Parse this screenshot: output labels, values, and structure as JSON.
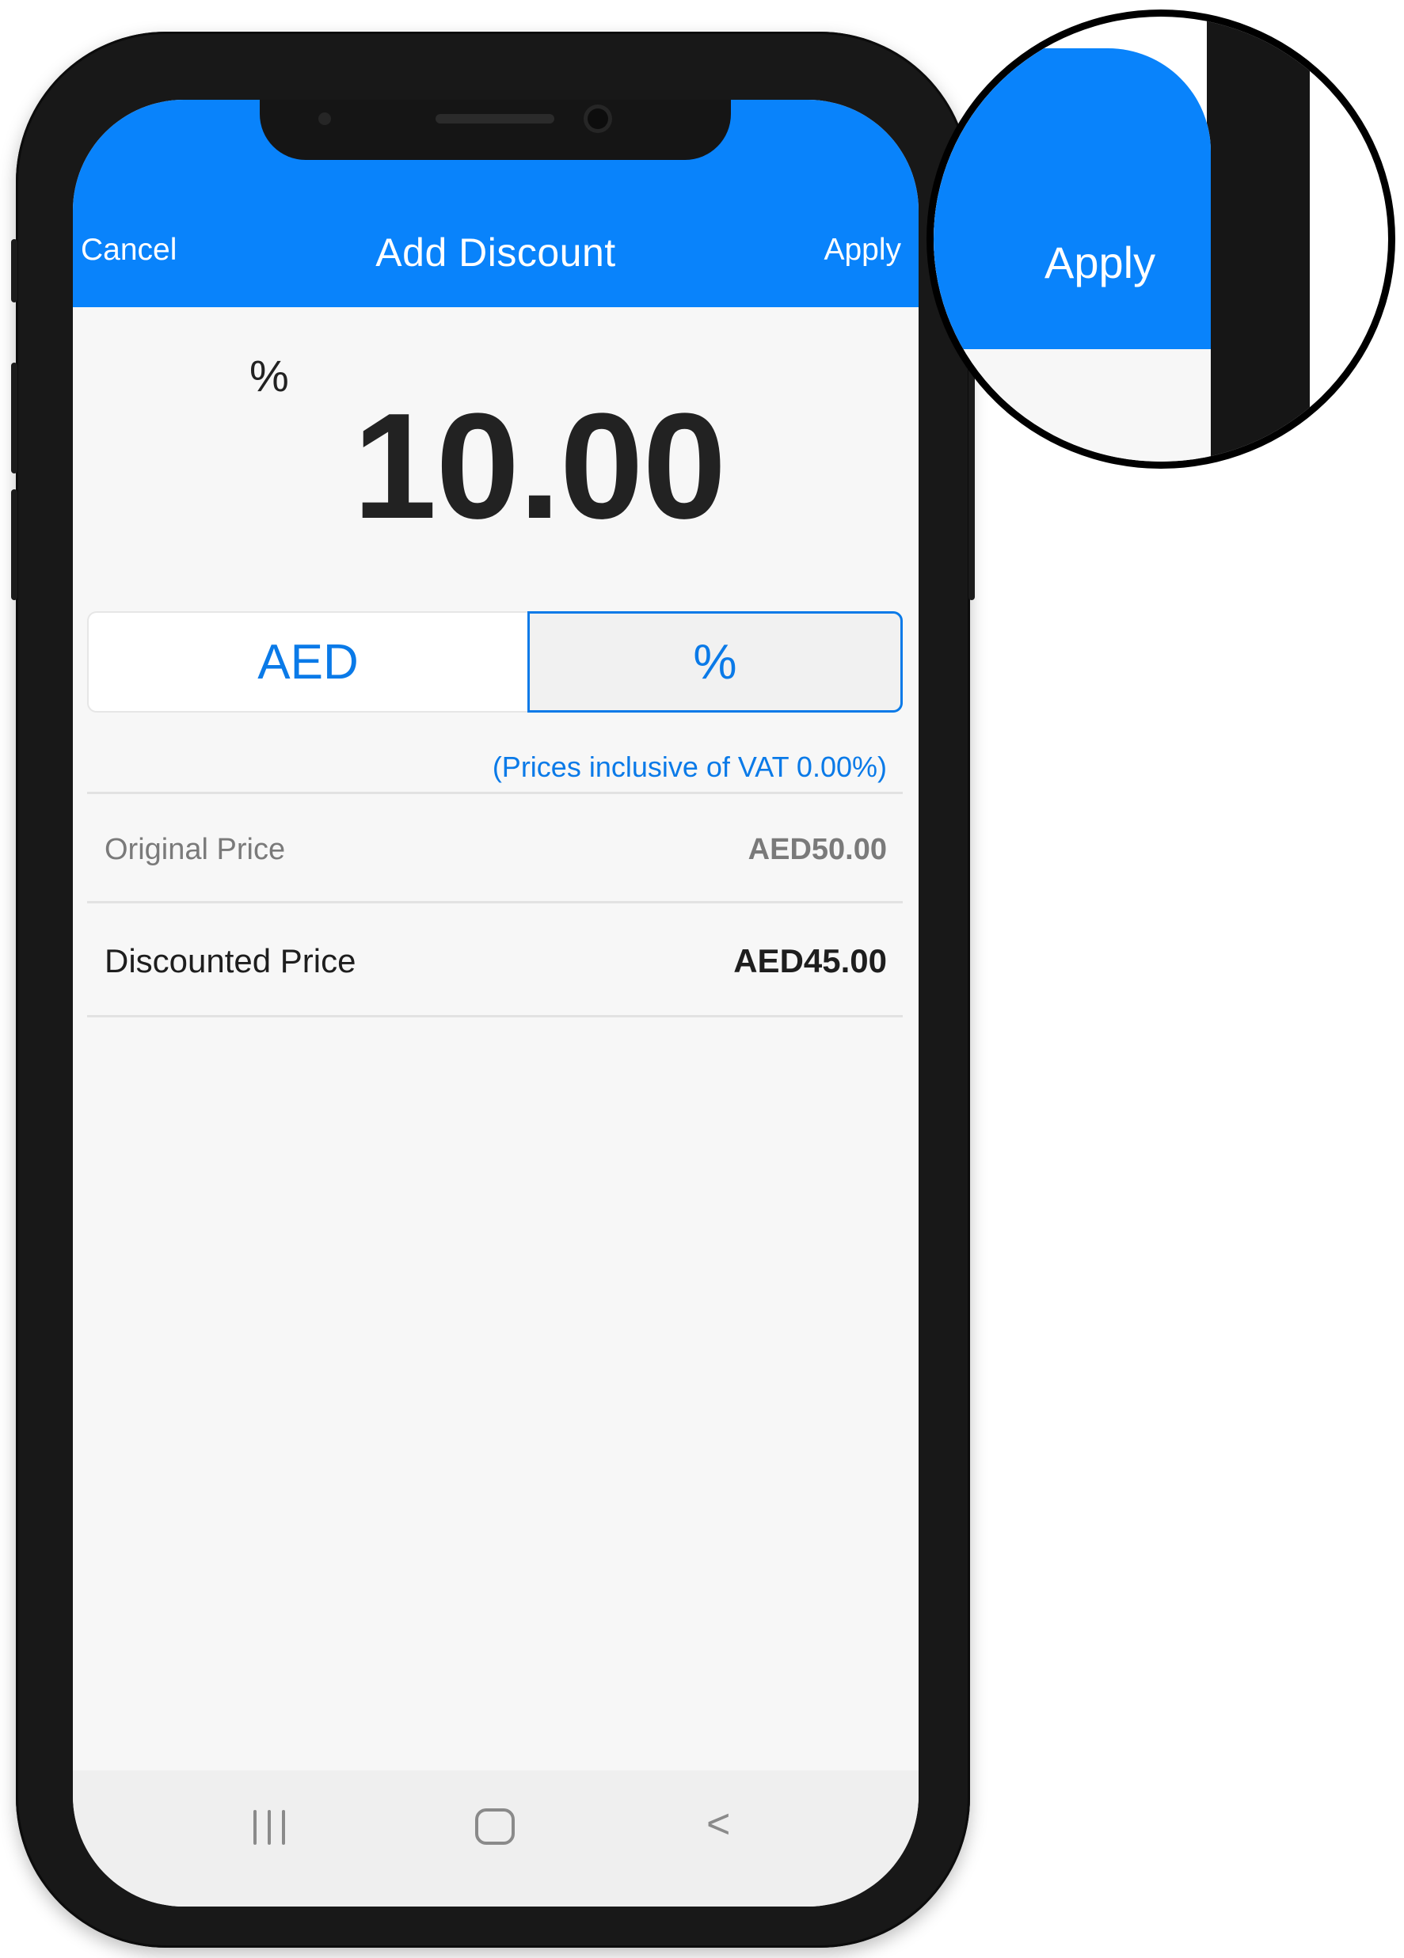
{
  "header": {
    "cancel_label": "Cancel",
    "title": "Add Discount",
    "apply_label": "Apply"
  },
  "discount": {
    "unit_label": "%",
    "amount": "10.00"
  },
  "mode_toggle": {
    "options": [
      "AED",
      "%"
    ],
    "selected": "%"
  },
  "vat_note": "(Prices inclusive of VAT 0.00%)",
  "prices": {
    "original_label": "Original Price",
    "original_value": "AED50.00",
    "discounted_label": "Discounted Price",
    "discounted_value": "AED45.00"
  },
  "navbar": {
    "recents_icon": "recents-icon",
    "home_icon": "home-icon",
    "back_icon": "back-icon",
    "back_glyph": "<"
  },
  "zoom_callout": {
    "apply_label": "Apply"
  },
  "colors": {
    "accent": "#0983fb",
    "link": "#0a7ae8",
    "phone_frame": "#181818"
  }
}
